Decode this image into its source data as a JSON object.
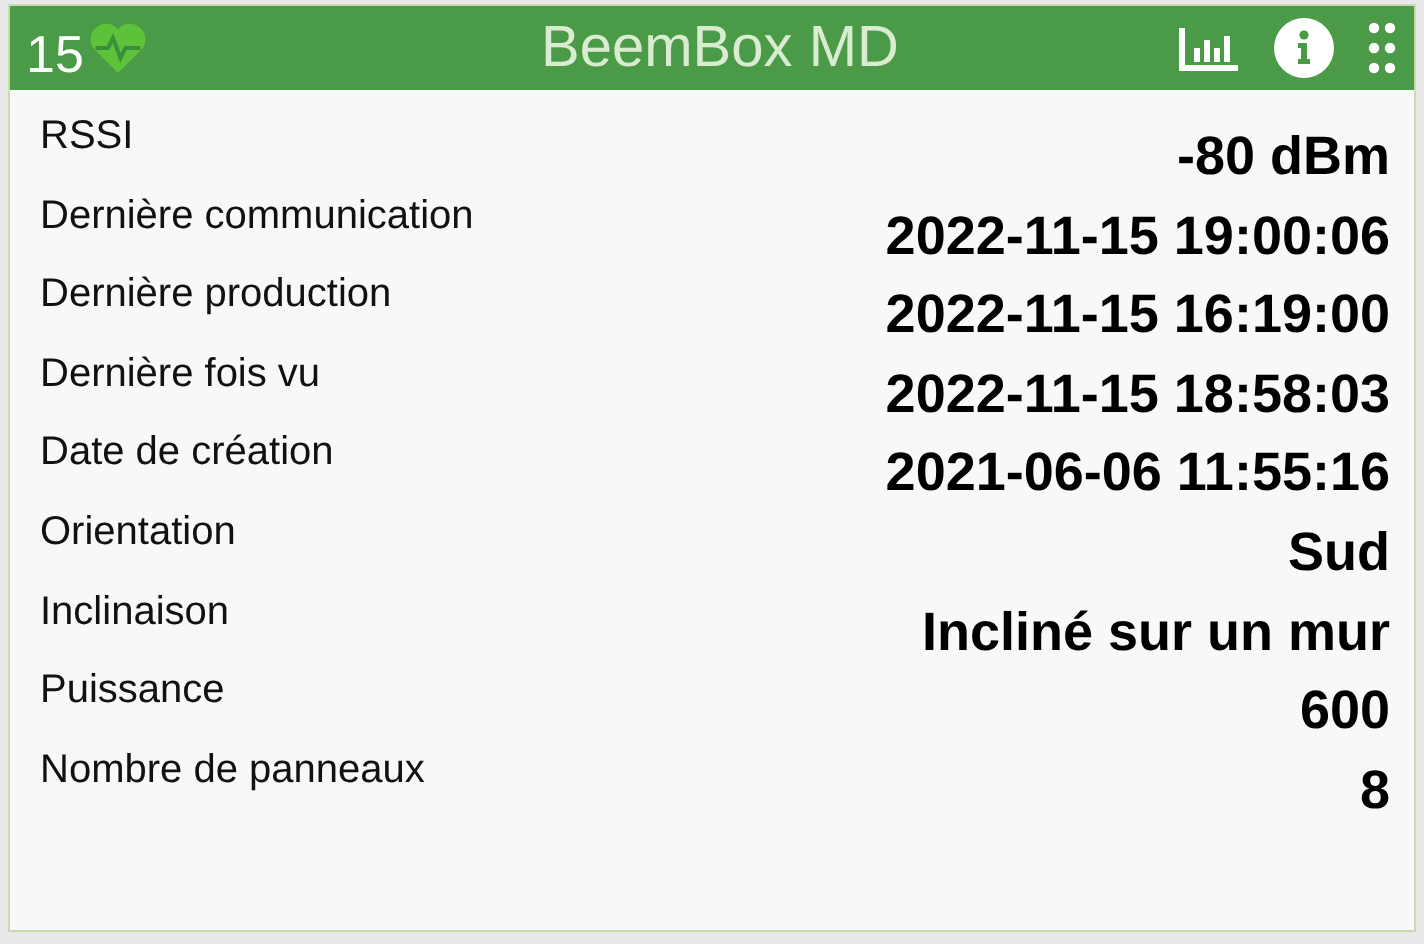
{
  "header": {
    "badge": "15",
    "title": "BeemBox MD"
  },
  "rows": [
    {
      "label": "RSSI",
      "value": "-80 dBm"
    },
    {
      "label": "Dernière communication",
      "value": "2022-11-15 19:00:06"
    },
    {
      "label": "Dernière production",
      "value": "2022-11-15 16:19:00"
    },
    {
      "label": "Dernière fois vu",
      "value": "2022-11-15 18:58:03"
    },
    {
      "label": "Date de création",
      "value": "2021-06-06 11:55:16"
    },
    {
      "label": "Orientation",
      "value": "Sud"
    },
    {
      "label": "Inclinaison",
      "value": "Incliné sur un mur"
    },
    {
      "label": "Puissance",
      "value": "600"
    },
    {
      "label": "Nombre de panneaux",
      "value": "8"
    }
  ]
}
